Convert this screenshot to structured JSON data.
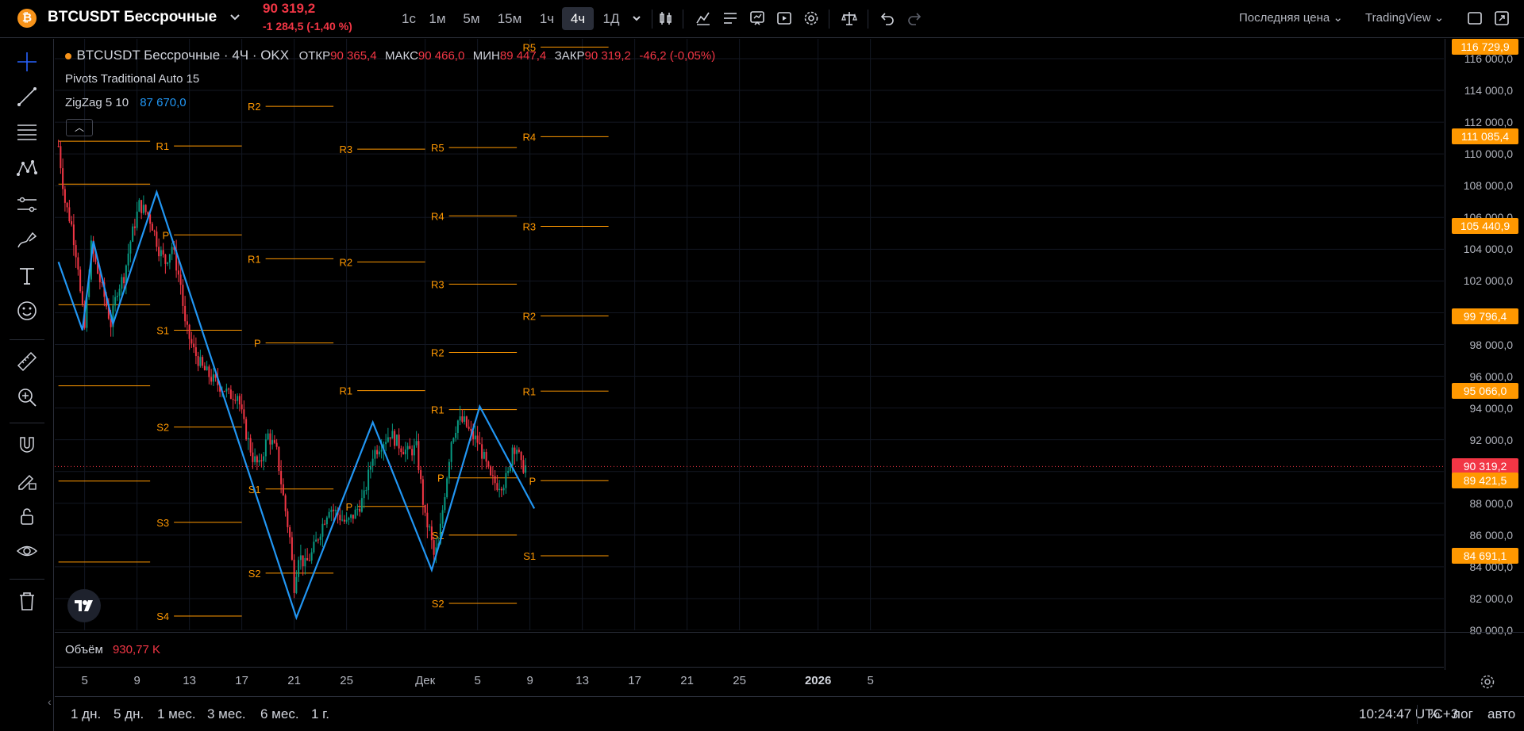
{
  "symbol": {
    "logo_letter": "₿",
    "name": "BTCUSDT Бессрочные",
    "price": "90 319,2",
    "change": "-1 284,5 (-1,40 %)"
  },
  "timeframes": [
    {
      "label": "1с",
      "active": false
    },
    {
      "label": "1м",
      "active": false
    },
    {
      "label": "5м",
      "active": false
    },
    {
      "label": "15м",
      "active": false
    },
    {
      "label": "1ч",
      "active": false
    },
    {
      "label": "4ч",
      "active": true
    },
    {
      "label": "1Д",
      "active": false
    }
  ],
  "toolbar_icons": [
    "chevron-down-icon",
    "candles-icon",
    "indicators-icon",
    "templates-icon",
    "alert-icon",
    "replay-icon",
    "settings-icon",
    "compare-icon",
    "undo-icon",
    "redo-icon"
  ],
  "top_right": {
    "price_type": "Последняя цена",
    "source": "TradingView"
  },
  "left_tools": [
    "crosshair-icon",
    "trendline-icon",
    "fib-icon",
    "pattern-icon",
    "forecast-icon",
    "brush-icon",
    "text-icon",
    "emoji-icon",
    "ruler-icon",
    "zoom-icon",
    "magnet-icon",
    "lock-draw-icon",
    "unlock-icon",
    "eye-icon",
    "trash-icon"
  ],
  "legend": {
    "title": "BTCUSDT Бессрочные · 4Ч · OKX",
    "open_label": "ОТКР",
    "open": "90 365,4",
    "high_label": "МАКС",
    "high": "90 466,0",
    "low_label": "МИН",
    "low": "89 447,4",
    "close_label": "ЗАКР",
    "close": "90 319,2",
    "change": "-46,2 (-0,05%)"
  },
  "indicators": {
    "pivots": "Pivots Traditional Auto 15",
    "zigzag_label": "ZigZag 5 10",
    "zigzag_value": "87 670,0"
  },
  "volume": {
    "label": "Объём",
    "value": "930,77 K"
  },
  "price_scale": {
    "ticks": [
      "116 000,0",
      "114 000,0",
      "112 000,0",
      "110 000,0",
      "108 000,0",
      "106 000,0",
      "104 000,0",
      "102 000,0",
      "100 000,0",
      "98 000,0",
      "96 000,0",
      "94 000,0",
      "92 000,0",
      "90 000,0",
      "88 000,0",
      "86 000,0",
      "84 000,0",
      "82 000,0",
      "80 000,0"
    ],
    "tick_values": [
      116000,
      114000,
      112000,
      110000,
      108000,
      106000,
      104000,
      102000,
      100000,
      98000,
      96000,
      94000,
      92000,
      90000,
      88000,
      86000,
      84000,
      82000,
      80000
    ],
    "labels": [
      {
        "text": "116 729,9",
        "value": 116729.9,
        "color": "#ff9800"
      },
      {
        "text": "111 085,4",
        "value": 111085.4,
        "color": "#ff9800"
      },
      {
        "text": "105 440,9",
        "value": 105440.9,
        "color": "#ff9800"
      },
      {
        "text": "99 796,4",
        "value": 99796.4,
        "color": "#ff9800"
      },
      {
        "text": "95 066,0",
        "value": 95066.0,
        "color": "#ff9800"
      },
      {
        "text": "90 319,2",
        "value": 90319.2,
        "color": "#f23645"
      },
      {
        "text": "89 421,5",
        "value": 89421.5,
        "color": "#ff9800"
      },
      {
        "text": "84 691,1",
        "value": 84691.1,
        "color": "#ff9800"
      }
    ]
  },
  "time_axis": [
    {
      "label": "5",
      "bar": 12
    },
    {
      "label": "9",
      "bar": 36
    },
    {
      "label": "13",
      "bar": 60
    },
    {
      "label": "17",
      "bar": 84
    },
    {
      "label": "21",
      "bar": 108
    },
    {
      "label": "25",
      "bar": 132
    },
    {
      "label": "Дек",
      "bar": 168
    },
    {
      "label": "5",
      "bar": 192
    },
    {
      "label": "9",
      "bar": 216
    },
    {
      "label": "13",
      "bar": 240
    },
    {
      "label": "17",
      "bar": 264
    },
    {
      "label": "21",
      "bar": 288
    },
    {
      "label": "25",
      "bar": 312
    },
    {
      "label": "2026",
      "bar": 348,
      "bold": true
    },
    {
      "label": "5",
      "bar": 372
    }
  ],
  "bottom": {
    "ranges": [
      "1 дн.",
      "5 дн.",
      "1 мес.",
      "3 мес.",
      "6 мес.",
      "1 г."
    ],
    "clock": "10:24:47 UTC+3",
    "percent": "%",
    "log": "лог",
    "auto": "авто"
  },
  "chart_data": {
    "type": "candlestick",
    "ylim": [
      80000,
      117500
    ],
    "candle_anchors": [
      [
        0,
        110500
      ],
      [
        3,
        107000
      ],
      [
        6,
        105500
      ],
      [
        9,
        103000
      ],
      [
        10,
        101200
      ],
      [
        12,
        99000
      ],
      [
        15,
        104200
      ],
      [
        18,
        102500
      ],
      [
        21,
        101000
      ],
      [
        24,
        99300
      ],
      [
        27,
        101500
      ],
      [
        30,
        102300
      ],
      [
        33,
        104500
      ],
      [
        37,
        106800
      ],
      [
        41,
        106200
      ],
      [
        43,
        105500
      ],
      [
        46,
        104000
      ],
      [
        49,
        103200
      ],
      [
        52,
        104200
      ],
      [
        56,
        101800
      ],
      [
        58,
        99200
      ],
      [
        62,
        97600
      ],
      [
        66,
        96500
      ],
      [
        72,
        95600
      ],
      [
        76,
        95200
      ],
      [
        78,
        94800
      ],
      [
        82,
        94900
      ],
      [
        85,
        92900
      ],
      [
        89,
        90900
      ],
      [
        92,
        90300
      ],
      [
        96,
        92300
      ],
      [
        100,
        91200
      ],
      [
        103,
        88400
      ],
      [
        106,
        85800
      ],
      [
        108,
        82800
      ],
      [
        110,
        84800
      ],
      [
        113,
        84100
      ],
      [
        116,
        84800
      ],
      [
        120,
        86300
      ],
      [
        124,
        87800
      ],
      [
        128,
        87300
      ],
      [
        132,
        86700
      ],
      [
        136,
        87400
      ],
      [
        140,
        88400
      ],
      [
        144,
        91100
      ],
      [
        148,
        91800
      ],
      [
        152,
        92400
      ],
      [
        156,
        91700
      ],
      [
        160,
        91200
      ],
      [
        164,
        91500
      ],
      [
        168,
        87000
      ],
      [
        170,
        86300
      ],
      [
        172,
        84700
      ],
      [
        174,
        85300
      ],
      [
        176,
        87600
      ],
      [
        178,
        89800
      ],
      [
        180,
        92000
      ],
      [
        183,
        93200
      ],
      [
        186,
        93100
      ],
      [
        189,
        92300
      ],
      [
        192,
        91900
      ],
      [
        195,
        90800
      ],
      [
        198,
        89500
      ],
      [
        201,
        89200
      ],
      [
        204,
        89300
      ],
      [
        206,
        89800
      ],
      [
        208,
        91600
      ],
      [
        210,
        91500
      ],
      [
        212,
        90300
      ],
      [
        214,
        90319
      ]
    ],
    "zigzag": [
      [
        0,
        103200
      ],
      [
        11,
        98900
      ],
      [
        16,
        104500
      ],
      [
        25,
        99300
      ],
      [
        45,
        107600
      ],
      [
        109,
        80800
      ],
      [
        144,
        93100
      ],
      [
        171,
        83800
      ],
      [
        193,
        94100
      ],
      [
        218,
        87670
      ]
    ],
    "pivots": [
      {
        "bars": [
          0,
          42
        ],
        "levels": [
          {
            "name": "P",
            "v": 108100
          },
          {
            "name": "R1",
            "v": 110800
          },
          {
            "name": "R2",
            "v": 118500
          },
          {
            "name": "S1",
            "v": 100500
          },
          {
            "name": "S2",
            "v": 95400
          },
          {
            "name": "S3",
            "v": 89400
          },
          {
            "name": "S4",
            "v": 84300
          }
        ],
        "labels": false
      },
      {
        "bars": [
          42,
          84
        ],
        "levels": [
          {
            "name": "R2",
            "v": 117500
          },
          {
            "name": "R1",
            "v": 110500
          },
          {
            "name": "P",
            "v": 104900
          },
          {
            "name": "S1",
            "v": 98900
          },
          {
            "name": "S2",
            "v": 92800
          },
          {
            "name": "S3",
            "v": 86800
          },
          {
            "name": "S4",
            "v": 80900
          }
        ],
        "labels": true
      },
      {
        "bars": [
          84,
          126
        ],
        "levels": [
          {
            "name": "R2",
            "v": 113000
          },
          {
            "name": "R1",
            "v": 103400
          },
          {
            "name": "P",
            "v": 98100
          },
          {
            "name": "S1",
            "v": 88900
          },
          {
            "name": "S2",
            "v": 83600
          }
        ],
        "labels": true
      },
      {
        "bars": [
          126,
          168
        ],
        "levels": [
          {
            "name": "R3",
            "v": 110300
          },
          {
            "name": "R2",
            "v": 103200
          },
          {
            "name": "R1",
            "v": 95100
          },
          {
            "name": "P",
            "v": 87800
          }
        ],
        "labels": true
      },
      {
        "bars": [
          168,
          210
        ],
        "levels": [
          {
            "name": "R5",
            "v": 110400
          },
          {
            "name": "R4",
            "v": 106100
          },
          {
            "name": "R3",
            "v": 101800
          },
          {
            "name": "R2",
            "v": 97500
          },
          {
            "name": "R1",
            "v": 93900
          },
          {
            "name": "P",
            "v": 89600
          },
          {
            "name": "S1",
            "v": 86000
          },
          {
            "name": "S2",
            "v": 81700
          }
        ],
        "labels": true
      },
      {
        "bars": [
          210,
          252
        ],
        "levels": [
          {
            "name": "R5",
            "v": 116730
          },
          {
            "name": "R4",
            "v": 111085
          },
          {
            "name": "R3",
            "v": 105441
          },
          {
            "name": "R2",
            "v": 99796
          },
          {
            "name": "R1",
            "v": 95066
          },
          {
            "name": "P",
            "v": 89422
          },
          {
            "name": "S1",
            "v": 84691
          }
        ],
        "labels": true
      }
    ],
    "last_price": 90319.2
  }
}
